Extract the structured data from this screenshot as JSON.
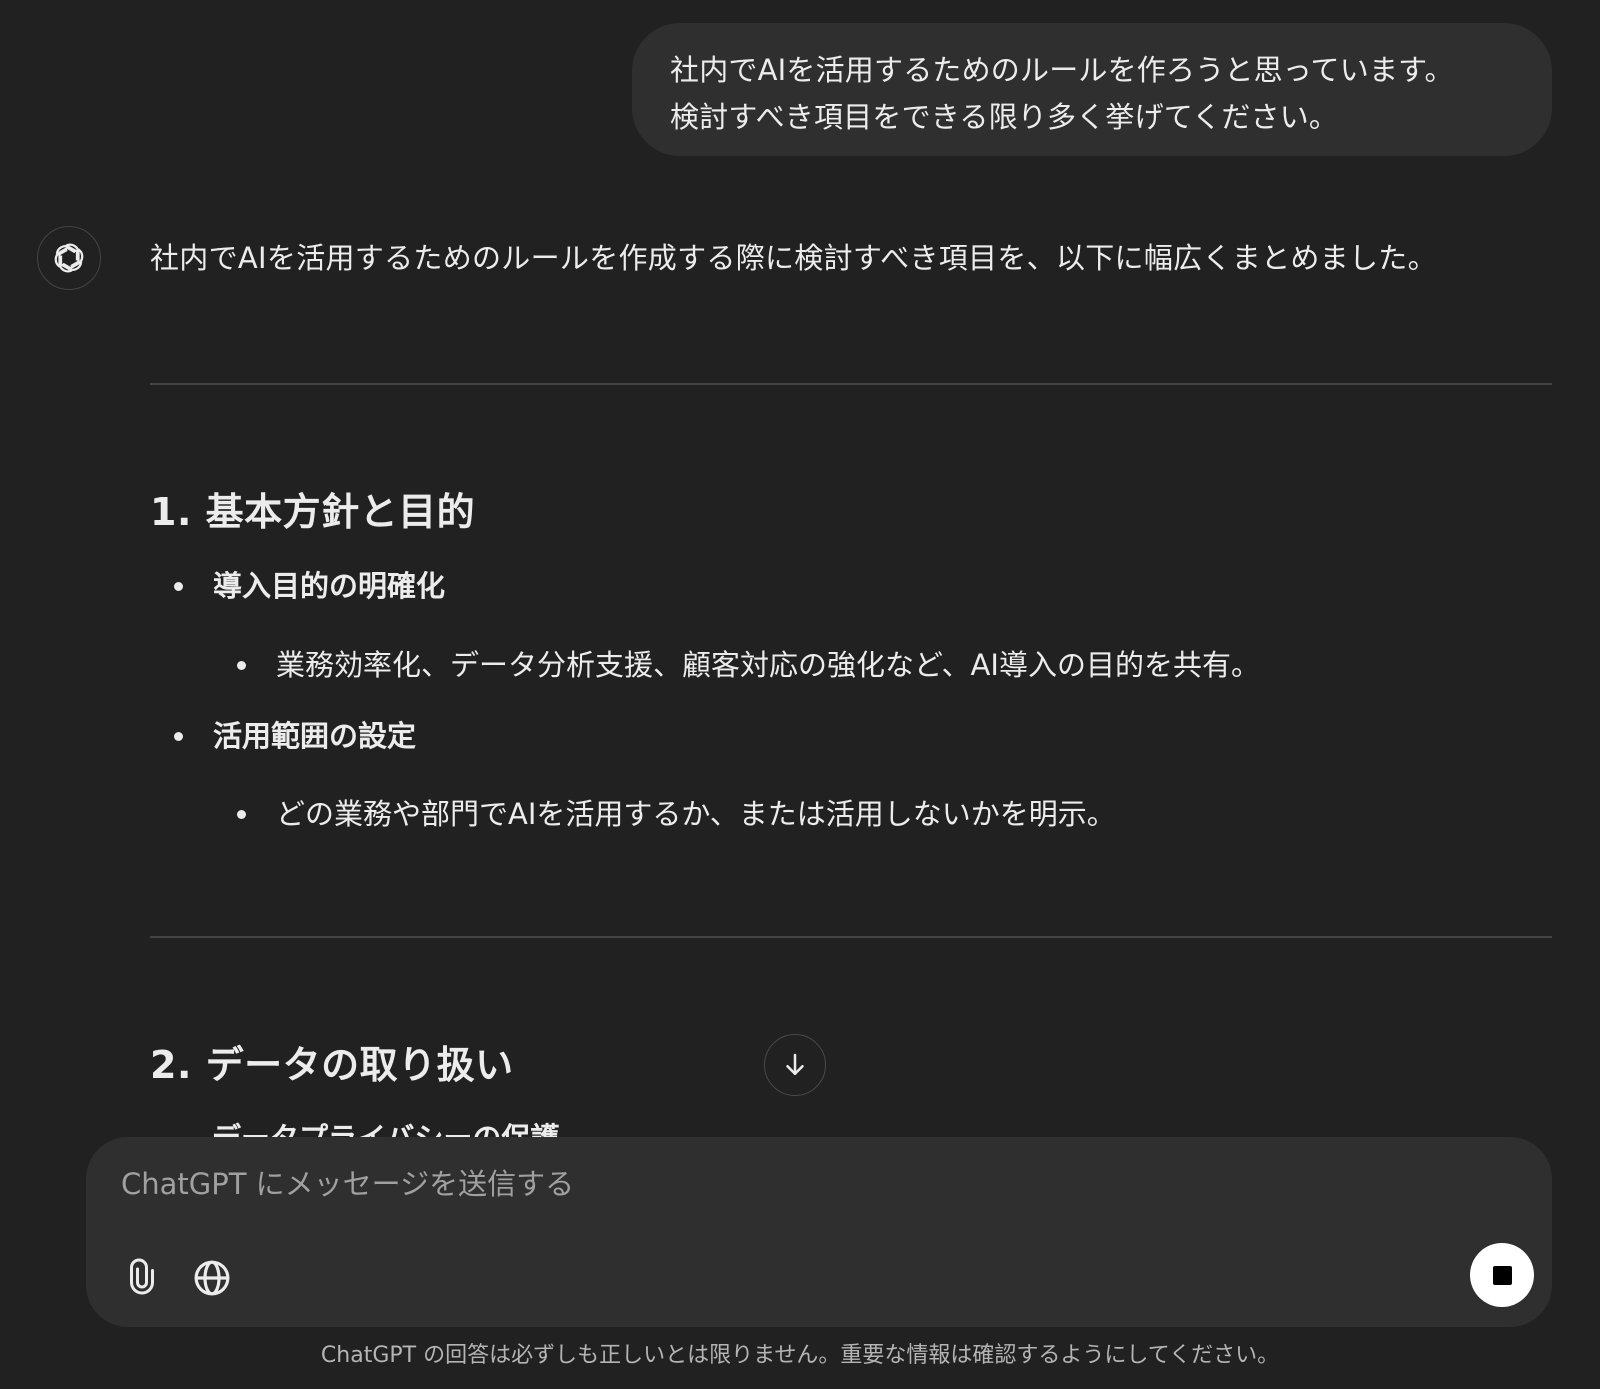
{
  "conversation": {
    "user_message": {
      "lines": [
        "社内でAIを活用するためのルールを作ろうと思っています。",
        "検討すべき項目をできる限り多く挙げてください。"
      ]
    },
    "assistant": {
      "avatar_icon": "chatgpt-logo-icon",
      "intro": "社内でAIを活用するためのルールを作成する際に検討すべき項目を、以下に幅広くまとめました。",
      "sections": [
        {
          "heading": "1. 基本方針と目的",
          "items": [
            {
              "title": "導入目的の明確化",
              "details": [
                "業務効率化、データ分析支援、顧客対応の強化など、AI導入の目的を共有。"
              ]
            },
            {
              "title": "活用範囲の設定",
              "details": [
                "どの業務や部門でAIを活用するか、または活用しないかを明示。"
              ]
            }
          ]
        },
        {
          "heading": "2. データの取り扱い",
          "items": [
            {
              "title": "データプライバシーの保護",
              "details": []
            }
          ]
        }
      ]
    }
  },
  "scroll_button": {
    "icon": "arrow-down-icon"
  },
  "composer": {
    "placeholder": "ChatGPT にメッセージを送信する",
    "value": "",
    "attach_icon": "paperclip-icon",
    "web_search_icon": "globe-icon",
    "stop_icon": "stop-icon"
  },
  "footer": {
    "disclaimer": "ChatGPT の回答は必ずしも正しいとは限りません。重要な情報は確認するようにしてください。"
  },
  "colors": {
    "background": "#212121",
    "bubble": "#2f2f2f",
    "text": "#ececec",
    "muted_text": "#b4b4b4",
    "divider": "#444444",
    "stop_button": "#ffffff"
  }
}
